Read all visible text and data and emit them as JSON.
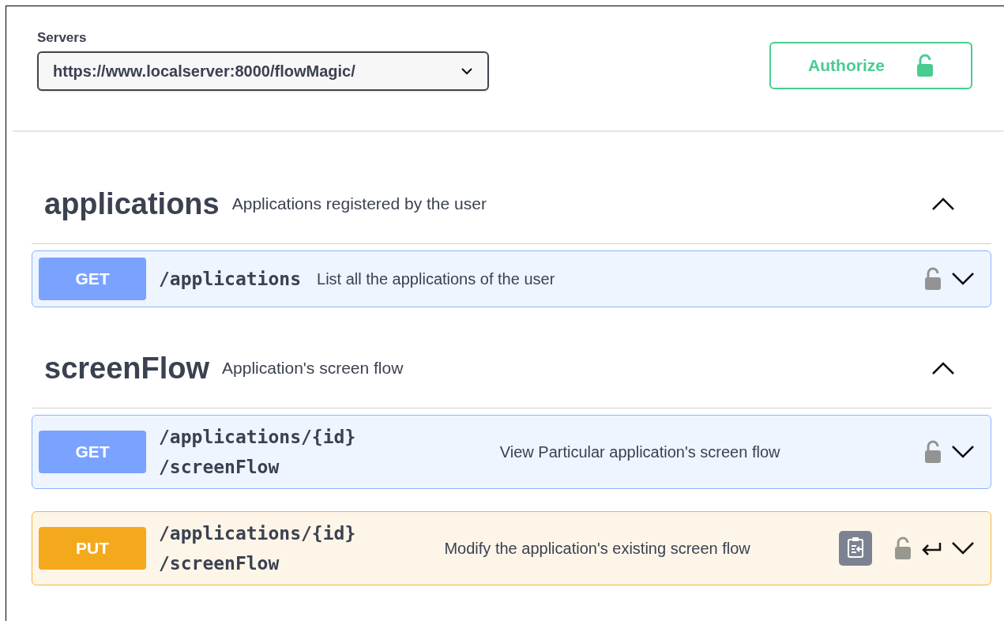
{
  "servers": {
    "label": "Servers",
    "value": "https://www.localserver:8000/flowMagic/"
  },
  "authorize": {
    "label": "Authorize",
    "locked": false
  },
  "sections": [
    {
      "name": "applications",
      "description": "Applications registered by the user",
      "expanded": true,
      "endpoints": [
        {
          "method": "GET",
          "kind": "get",
          "path_lines": [
            "/applications"
          ],
          "summary": "List all the applications of the user",
          "locked": false,
          "expanded": false,
          "edit_icons": false
        }
      ]
    },
    {
      "name": "screenFlow",
      "description": "Application's screen flow",
      "expanded": true,
      "endpoints": [
        {
          "method": "GET",
          "kind": "get",
          "path_lines": [
            "/applications/{id}",
            "/screenFlow"
          ],
          "summary": "View Particular application's screen flow",
          "locked": false,
          "expanded": false,
          "edit_icons": false
        },
        {
          "method": "PUT",
          "kind": "put",
          "path_lines": [
            "/applications/{id}",
            "/screenFlow"
          ],
          "summary": "Modify the application's existing screen flow",
          "locked": false,
          "expanded": false,
          "edit_icons": true
        }
      ]
    }
  ]
}
